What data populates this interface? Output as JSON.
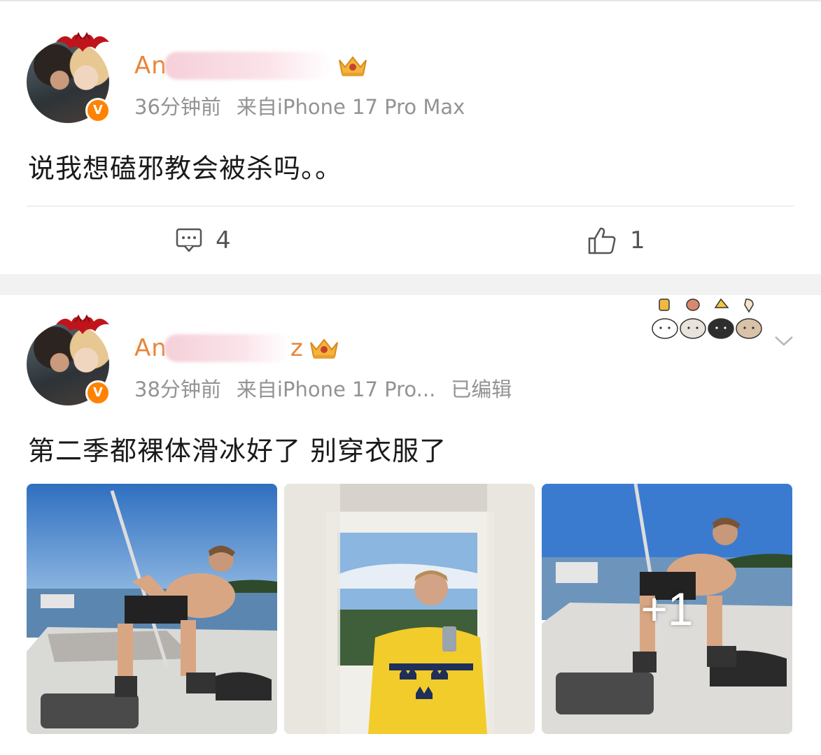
{
  "posts": [
    {
      "username": "An",
      "time": "36分钟前",
      "source": "来自iPhone 17 Pro Max",
      "edited": "",
      "text": "说我想磕邪教会被杀吗。。",
      "actions": {
        "comment_icon": "comment-icon",
        "comment_count": "4",
        "like_icon": "thumbs-up-icon",
        "like_count": "1"
      }
    },
    {
      "username": "An",
      "username_tail": "z",
      "time": "38分钟前",
      "source": "来自iPhone 17 Pro...",
      "edited": "已编辑",
      "text": "第二季都裸体滑冰好了 别穿衣服了",
      "images": {
        "more_count": "+1"
      }
    }
  ],
  "colors": {
    "username": "#e8853a",
    "meta": "#939393",
    "verified": "#ff8200",
    "feed_gap": "#f2f2f2"
  },
  "icons": {
    "verified": "verified-v-icon",
    "vip": "vip-crown-icon",
    "avatar_frame": "bat-frame-icon",
    "more": "chevron-down-icon"
  }
}
